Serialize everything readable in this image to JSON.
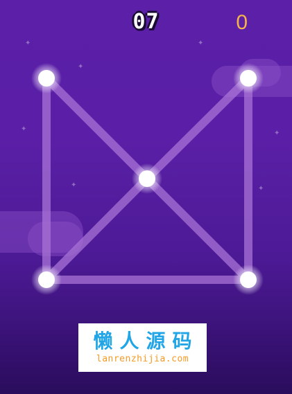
{
  "hud": {
    "level": "07",
    "score": "0"
  },
  "puzzle": {
    "nodes": [
      {
        "id": "top-left"
      },
      {
        "id": "top-right"
      },
      {
        "id": "center"
      },
      {
        "id": "bottom-left"
      },
      {
        "id": "bottom-right"
      }
    ],
    "edges": [
      [
        "top-left",
        "center"
      ],
      [
        "top-right",
        "center"
      ],
      [
        "top-left",
        "bottom-left"
      ],
      [
        "top-right",
        "bottom-right"
      ],
      [
        "center",
        "bottom-left"
      ],
      [
        "center",
        "bottom-right"
      ],
      [
        "bottom-left",
        "bottom-right"
      ]
    ]
  },
  "watermark": {
    "title": "懒人源码",
    "url": "lanrenzhijia.com"
  },
  "colors": {
    "background_top": "#5b1fa8",
    "background_bottom": "#2a0d5c",
    "line": "#a873d6",
    "node": "#ffffff",
    "score": "#f6b34a",
    "watermark_title": "#21a5e6",
    "watermark_url": "#f59a23"
  }
}
